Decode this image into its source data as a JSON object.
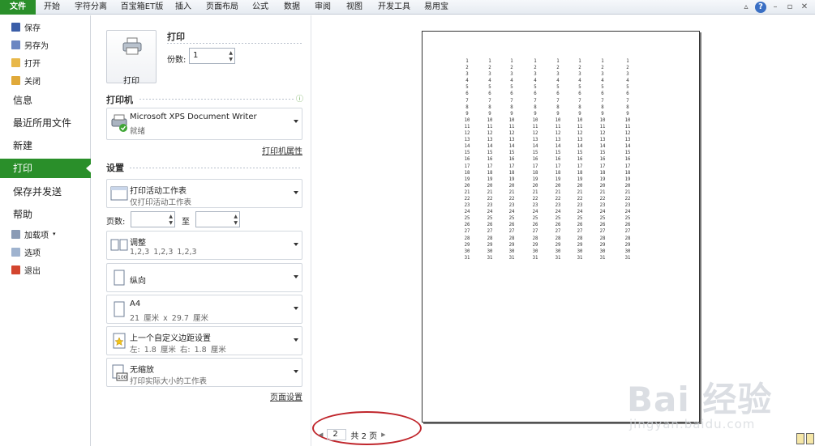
{
  "ribbon": {
    "tabs": [
      "文件",
      "开始",
      "字符分离",
      "百宝箱ET版",
      "插入",
      "页面布局",
      "公式",
      "数据",
      "审阅",
      "视图",
      "开发工具",
      "易用宝"
    ],
    "help": "?"
  },
  "nav": {
    "save": "保存",
    "save_as": "另存为",
    "open": "打开",
    "close": "关闭",
    "info": "信息",
    "recent": "最近所用文件",
    "new": "新建",
    "print": "打印",
    "save_send": "保存并发送",
    "help": "帮助",
    "addins": "加载项",
    "options": "选项",
    "exit": "退出"
  },
  "print": {
    "section_title": "打印",
    "button_label": "打印",
    "copies_label": "份数:",
    "copies_value": "1"
  },
  "printer": {
    "section_title": "打印机",
    "name": "Microsoft XPS Document Writer",
    "status": "就绪",
    "properties_link": "打印机属性"
  },
  "settings": {
    "section_title": "设置",
    "scope_main": "打印活动工作表",
    "scope_sub": "仅打印活动工作表",
    "pages_label": "页数:",
    "pages_to": "至",
    "collate_main": "调整",
    "collate_sub": "1,2,3    1,2,3    1,2,3",
    "orientation": "纵向",
    "paper_main": "A4",
    "paper_sub": "21 厘米 x 29.7 厘米",
    "margins_main": "上一个自定义边距设置",
    "margins_sub": "左: 1.8 厘米    右: 1.8 厘米",
    "scale_main": "无缩放",
    "scale_sub": "打印实际大小的工作表",
    "page_setup_link": "页面设置"
  },
  "preview": {
    "numbers": [
      "1",
      "2",
      "3",
      "4",
      "5",
      "6",
      "7",
      "8",
      "9",
      "10",
      "11",
      "12",
      "13",
      "14",
      "15",
      "16",
      "17",
      "18",
      "19",
      "20",
      "21",
      "22",
      "23",
      "24",
      "25",
      "26",
      "27",
      "28",
      "29",
      "30",
      "31"
    ],
    "current_page": "2",
    "total_pages": "共 2 页"
  },
  "watermark": {
    "brand": "Bai 经验",
    "url": "jingyan.baidu.com"
  },
  "colors": {
    "accent_green": "#2a8f2a",
    "annotation_red": "#c0262c"
  }
}
